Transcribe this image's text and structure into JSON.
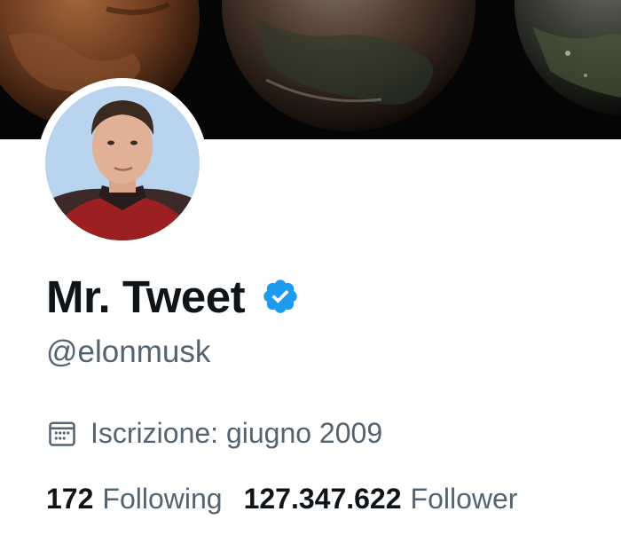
{
  "profile": {
    "display_name": "Mr. Tweet",
    "verified": true,
    "handle": "@elonmusk",
    "joined": "Iscrizione: giugno 2009",
    "following_count": "172",
    "following_label": "Following",
    "followers_count": "127.347.622",
    "followers_label": "Follower"
  },
  "icons": {
    "verified": "verified-badge-icon",
    "calendar": "calendar-icon"
  },
  "colors": {
    "primary_text": "#0f1419",
    "secondary_text": "#536471",
    "verified_blue": "#1d9bf0",
    "banner_background": "#050505"
  }
}
